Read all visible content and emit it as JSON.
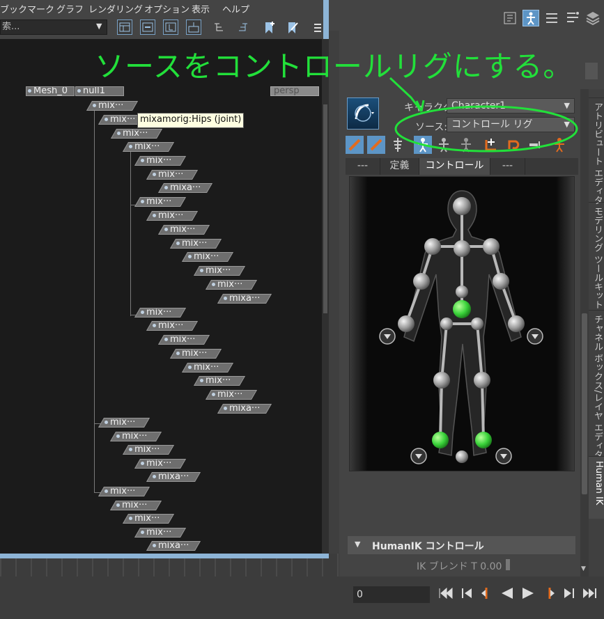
{
  "menu": [
    "ブックマーク",
    "グラフ",
    "レンダリング",
    "オプション",
    "表示",
    "ヘルプ"
  ],
  "search": {
    "placeholder": "索..."
  },
  "graph": {
    "tooltip": "mixamorig:Hips (joint)",
    "root_nodes": [
      "Mesh_0",
      "null1"
    ],
    "camera_node": "persp",
    "nodes": [
      "mix···",
      "mix···",
      "mix···",
      "mix···",
      "mix···",
      "mix···",
      "mixa···",
      "mix···",
      "mix···",
      "mix···",
      "mix···",
      "mix···",
      "mix···",
      "mix···",
      "mixa···",
      "mix···",
      "mix···",
      "mix···",
      "mix···",
      "mix···",
      "mix···",
      "mix···",
      "mixa···",
      "mix···",
      "mix···",
      "mix···",
      "mix···",
      "mixa···",
      "mix···",
      "mix···",
      "mix···",
      "mix···",
      "mixa···"
    ]
  },
  "annotation": {
    "text": "ソースをコントロールリグにする。",
    "color": "#22e03a"
  },
  "hik": {
    "character_label": "キャラクタ:",
    "character_value": "Character1",
    "source_label": "ソース:",
    "source_value": "コントロール リグ",
    "tabs": [
      "---",
      "定義",
      "コントロール",
      "---"
    ],
    "active_tab": "コントロール",
    "controls_section": "HumanIK コントロール",
    "ik_blend_label": "IK ブレンド T",
    "ik_blend_value": "0.00"
  },
  "side_tabs": [
    "アトリビュート エディタ",
    "モデリング ツールキット",
    "チャネル ボックス/レイヤ エディタ",
    "Human IK"
  ],
  "active_side_tab": "Human IK",
  "timeline": {
    "frame": "0"
  },
  "colors": {
    "accent": "#5d95c6",
    "highlight_green": "#3ad23a",
    "annotation": "#22e03a"
  }
}
